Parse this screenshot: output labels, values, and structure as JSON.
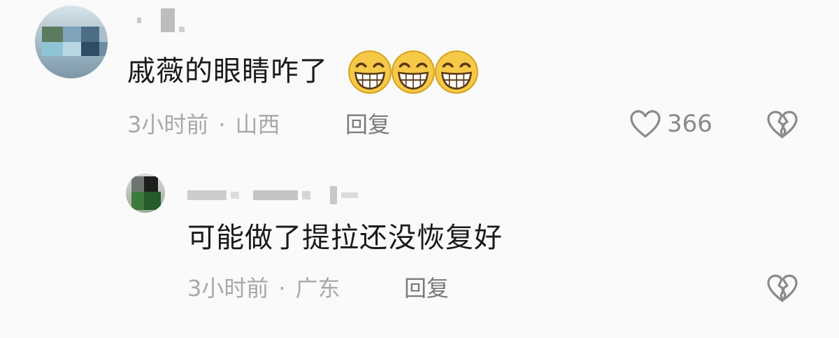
{
  "comments": [
    {
      "text": "戚薇的眼睛咋了",
      "emoji": "grinning-face-emoji",
      "emoji_count": 3,
      "time": "3小时前",
      "separator": "·",
      "location": "山西",
      "reply_label": "回复",
      "likes": "366"
    },
    {
      "text": "可能做了提拉还没恢复好",
      "time": "3小时前",
      "separator": "·",
      "location": "广东",
      "reply_label": "回复"
    }
  ],
  "icons": {
    "like": "heart-icon",
    "dislike": "broken-heart-icon"
  },
  "colors": {
    "background": "#fafafa",
    "text": "#1a1a1a",
    "meta": "#a8a8a8",
    "emoji": "#f7c948"
  }
}
